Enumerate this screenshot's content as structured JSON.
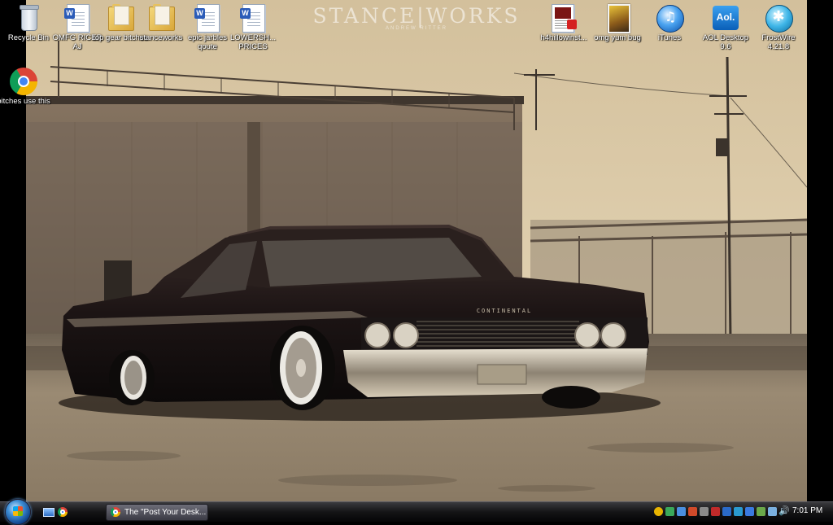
{
  "wallpaper": {
    "watermark_title": "STANCE|WORKS",
    "watermark_sub": "ANDREW RITTER",
    "car_badge": "CONTINENTAL"
  },
  "desktop_icons": [
    {
      "label": "Recycle Bin",
      "icon": "recycle-bin-icon"
    },
    {
      "label": "OMFG RICER AJ",
      "icon": "word-document-icon"
    },
    {
      "label": "top gear bitches",
      "icon": "folder-icon"
    },
    {
      "label": "stanceworks",
      "icon": "folder-icon"
    },
    {
      "label": "epic jarbles qoute",
      "icon": "word-document-icon"
    },
    {
      "label": "LOWERSH... PRICES",
      "icon": "word-document-icon"
    },
    {
      "label": "h4hillowinst...",
      "icon": "pdf-document-icon"
    },
    {
      "label": "omg yum bug",
      "icon": "photo-file-icon"
    },
    {
      "label": "iTunes",
      "icon": "itunes-icon"
    },
    {
      "label": "AOL Desktop 9.6",
      "icon": "aol-icon"
    },
    {
      "label": "FrostWire 4.21.8",
      "icon": "frostwire-icon"
    },
    {
      "label": "bitches use this",
      "icon": "chrome-icon"
    }
  ],
  "taskbar": {
    "active_window_title": "The \"Post Your Desk...",
    "clock": "7:01 PM"
  },
  "colors": {
    "taskbar": "#141416",
    "wallpaper_sky": "#cdb995"
  }
}
